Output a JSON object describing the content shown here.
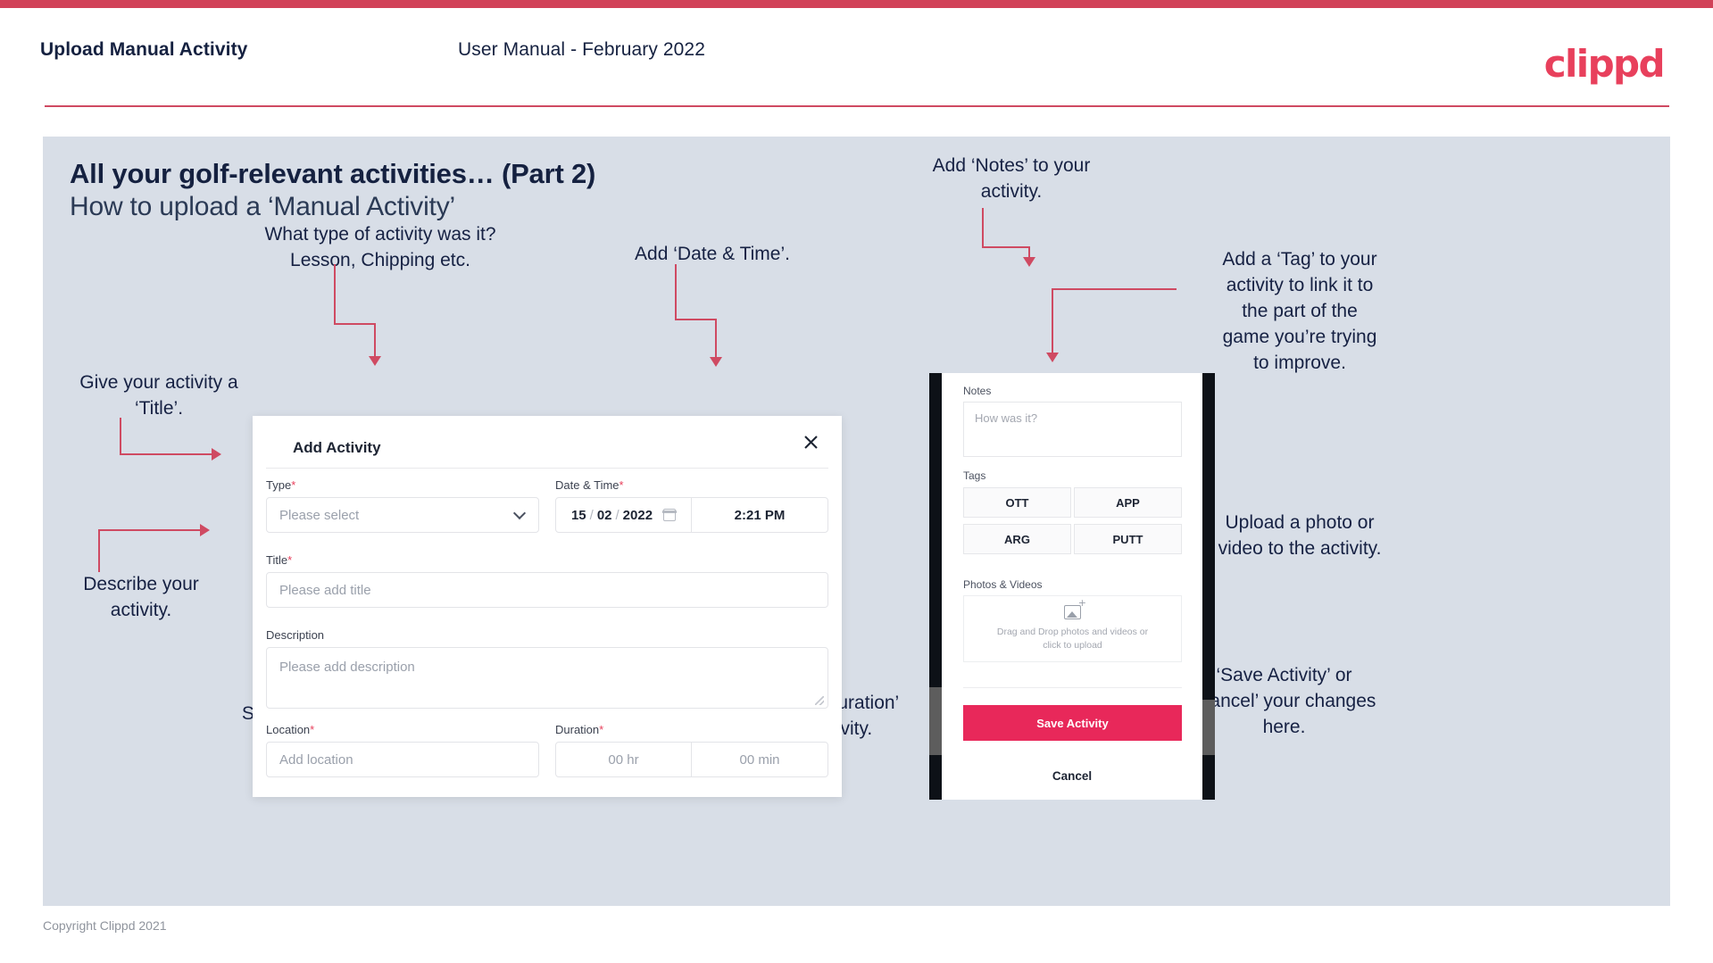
{
  "header": {
    "title": "Upload Manual Activity",
    "subtitle": "User Manual - February 2022",
    "logo": "clippd"
  },
  "slide": {
    "title_main": "All your golf-relevant activities… (Part 2)",
    "title_sub": "How to upload a ‘Manual Activity’"
  },
  "annotations": {
    "type": "What type of activity was it?\nLesson, Chipping etc.",
    "datetime": "Add ‘Date & Time’.",
    "title": "Give your activity a\n‘Title’.",
    "description": "Describe your\nactivity.",
    "location": "Specify the ‘Location’.",
    "duration": "Specify the ‘Duration’\nof your activity.",
    "notes": "Add ‘Notes’ to your\nactivity.",
    "tags": "Add a ‘Tag’ to your\nactivity to link it to\nthe part of the\ngame you’re trying\nto improve.",
    "upload": "Upload a photo or\nvideo to the activity.",
    "save": "‘Save Activity’ or\n‘Cancel’ your changes\nhere."
  },
  "dialog": {
    "title": "Add Activity",
    "close_icon": "close-icon",
    "fields": {
      "type": {
        "label": "Type",
        "required": "*",
        "placeholder": "Please select"
      },
      "datetime": {
        "label": "Date & Time",
        "required": "*",
        "day": "15",
        "month": "02",
        "year": "2022",
        "sep": "/",
        "time": "2:21 PM",
        "calendar_icon": "calendar-icon"
      },
      "title": {
        "label": "Title",
        "required": "*",
        "placeholder": "Please add title"
      },
      "description": {
        "label": "Description",
        "placeholder": "Please add description"
      },
      "location": {
        "label": "Location",
        "required": "*",
        "placeholder": "Add location"
      },
      "duration": {
        "label": "Duration",
        "required": "*",
        "hours": "00 hr",
        "minutes": "00 min"
      }
    }
  },
  "phone": {
    "notes": {
      "label": "Notes",
      "placeholder": "How was it?"
    },
    "tags": {
      "label": "Tags",
      "items": [
        "OTT",
        "APP",
        "ARG",
        "PUTT"
      ]
    },
    "photos": {
      "label": "Photos & Videos",
      "icon": "add-image-icon",
      "dropzone_line1": "Drag and Drop photos and videos or",
      "dropzone_line2": "click to upload"
    },
    "save_label": "Save Activity",
    "cancel_label": "Cancel"
  },
  "footer": {
    "copyright": "Copyright Clippd 2021"
  },
  "colors": {
    "accent": "#e8405c",
    "accent_bar": "#d14258",
    "connector": "#cf4a62",
    "slide_bg": "#d8dee7",
    "text_dark": "#152140",
    "save_button": "#e8285a"
  }
}
